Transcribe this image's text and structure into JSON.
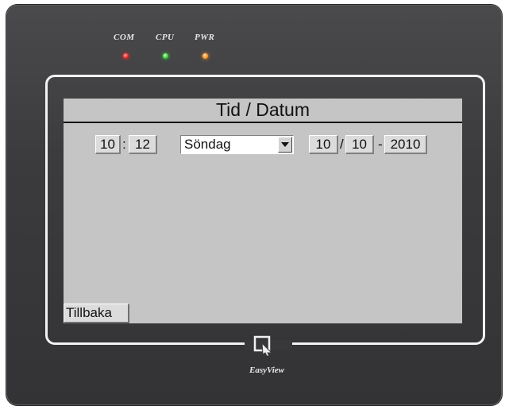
{
  "device": {
    "leds": {
      "com": "COM",
      "cpu": "CPU",
      "pwr": "PWR"
    },
    "brand": "EasyView"
  },
  "screen": {
    "title": "Tid / Datum",
    "time": {
      "hour": "10",
      "separator": ":",
      "minute": "12"
    },
    "weekday": {
      "selected": "Söndag"
    },
    "date": {
      "day": "10",
      "sep1": "/",
      "month": "10",
      "sep2": "-",
      "year": "2010"
    },
    "back_label": "Tillbaka"
  }
}
